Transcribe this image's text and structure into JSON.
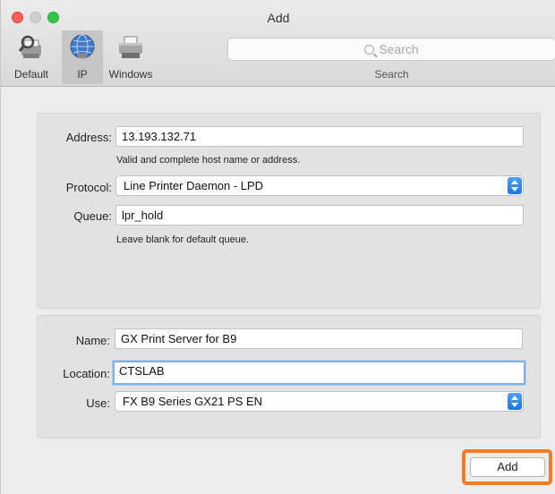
{
  "window": {
    "title": "Add"
  },
  "toolbar": {
    "items": [
      {
        "label": "Default",
        "icon": "default-printer-icon",
        "selected": false
      },
      {
        "label": "IP",
        "icon": "globe-icon",
        "selected": true
      },
      {
        "label": "Windows",
        "icon": "windows-printer-icon",
        "selected": false
      }
    ],
    "search": {
      "placeholder": "Search",
      "label": "Search"
    }
  },
  "connection": {
    "address_label": "Address:",
    "address_value": "13.193.132.71",
    "address_hint": "Valid and complete host name or address.",
    "protocol_label": "Protocol:",
    "protocol_value": "Line Printer Daemon - LPD",
    "queue_label": "Queue:",
    "queue_value": "lpr_hold",
    "queue_hint": "Leave blank for default queue."
  },
  "printer": {
    "name_label": "Name:",
    "name_value": "GX Print Server for B9",
    "location_label": "Location:",
    "location_value": "CTSLAB",
    "use_label": "Use:",
    "use_value": "FX B9 Series GX21 PS EN"
  },
  "footer": {
    "add_label": "Add",
    "highlight_color": "#f07d23"
  },
  "colors": {
    "close": "#fc5f57",
    "maximize": "#33c748",
    "focus_ring": "#7fb2ea",
    "popup_accent": "#1a74ea"
  }
}
